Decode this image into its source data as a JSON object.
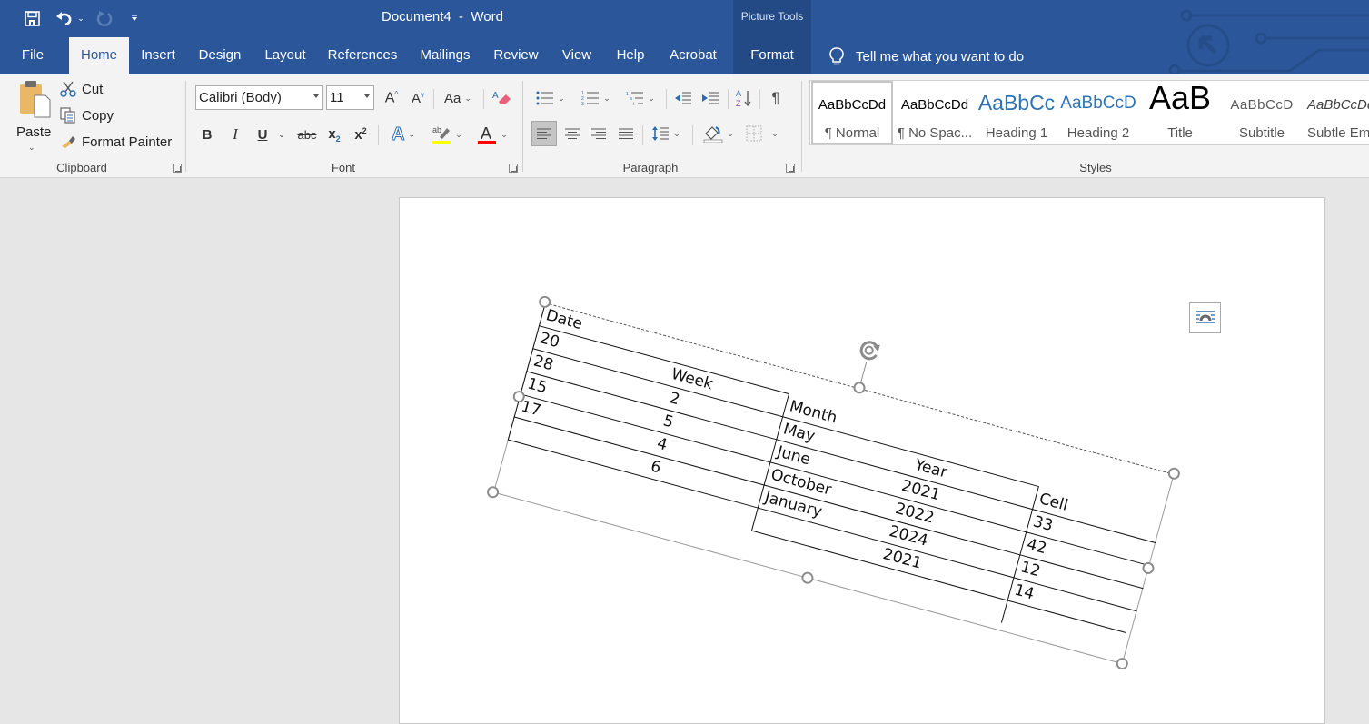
{
  "titlebar": {
    "document_title": "Document4  -  Word",
    "context_group": "Picture Tools",
    "qat": {
      "save": "save-icon",
      "undo": "undo-icon",
      "redo": "redo-icon",
      "customize": "customize-qat-icon"
    }
  },
  "tabs": [
    {
      "label": "File",
      "active": false
    },
    {
      "label": "Home",
      "active": true
    },
    {
      "label": "Insert",
      "active": false
    },
    {
      "label": "Design",
      "active": false
    },
    {
      "label": "Layout",
      "active": false
    },
    {
      "label": "References",
      "active": false
    },
    {
      "label": "Mailings",
      "active": false
    },
    {
      "label": "Review",
      "active": false
    },
    {
      "label": "View",
      "active": false
    },
    {
      "label": "Help",
      "active": false
    },
    {
      "label": "Acrobat",
      "active": false
    },
    {
      "label": "Format",
      "active": false,
      "contextual": true
    }
  ],
  "tell_me": {
    "placeholder": "Tell me what you want to do"
  },
  "ribbon": {
    "clipboard": {
      "label": "Clipboard",
      "paste": "Paste",
      "cut": "Cut",
      "copy": "Copy",
      "format_painter": "Format Painter"
    },
    "font": {
      "label": "Font",
      "font_name": "Calibri (Body)",
      "font_size": "11",
      "change_case": "Aa",
      "bold": "B",
      "italic": "I",
      "underline": "U",
      "strikethrough": "abc",
      "subscript": "x",
      "superscript": "x",
      "highlight_color": "#ffff00",
      "font_color": "#ff0000"
    },
    "paragraph": {
      "label": "Paragraph",
      "pilcrow": "¶"
    },
    "styles": {
      "label": "Styles",
      "items": [
        {
          "sample": "AaBbCcDd",
          "name": "¶ Normal",
          "selected": true
        },
        {
          "sample": "AaBbCcDd",
          "name": "¶ No Spac...",
          "selected": false
        },
        {
          "sample": "AaBbCc",
          "name": "Heading 1",
          "selected": false
        },
        {
          "sample": "AaBbCcD",
          "name": "Heading 2",
          "selected": false
        },
        {
          "sample": "AaB",
          "name": "Title",
          "selected": false
        },
        {
          "sample": "AaBbCcD",
          "name": "Subtitle",
          "selected": false
        },
        {
          "sample": "AaBbCcDd",
          "name": "Subtle Em...",
          "selected": false
        }
      ]
    }
  },
  "document": {
    "picture_table": {
      "block1": {
        "headers": [
          "Date",
          "Week"
        ],
        "rows": [
          [
            "20",
            ""
          ],
          [
            "28",
            "2"
          ],
          [
            "15",
            "5"
          ],
          [
            "17",
            "4"
          ],
          [
            "",
            "6"
          ]
        ]
      },
      "block1_week_values": [
        "Week",
        "2",
        "5",
        "4",
        "6"
      ],
      "block1_date_values": [
        "Date",
        "20",
        "28",
        "15",
        "17"
      ],
      "block2": {
        "headers": [
          "Month",
          "Year"
        ],
        "month_values": [
          "Month",
          "May",
          "June",
          "October",
          "January"
        ],
        "year_values": [
          "Year",
          "2021",
          "2022",
          "2024",
          "2021"
        ]
      },
      "block3": {
        "header": "Cell",
        "values": [
          "Cell",
          "33",
          "42",
          "12",
          "14"
        ]
      }
    }
  }
}
